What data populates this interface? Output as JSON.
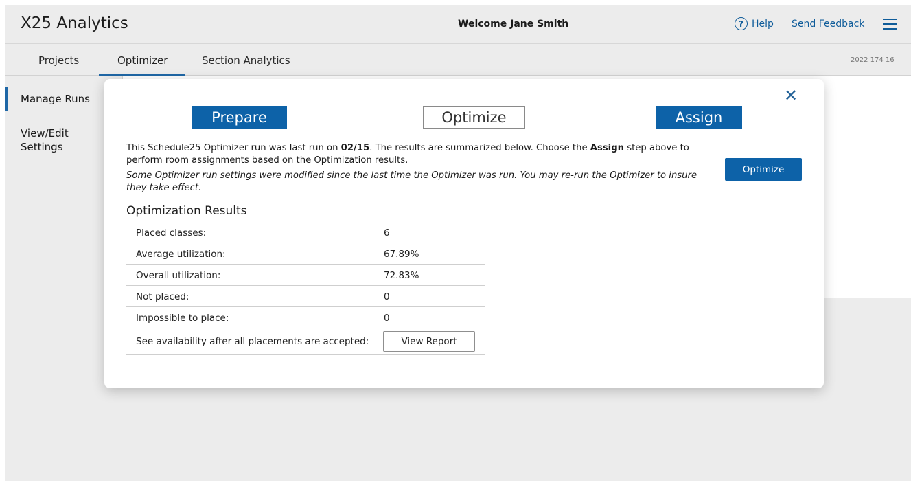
{
  "header": {
    "brand": "X25 Analytics",
    "welcome": "Welcome Jane Smith",
    "help_icon_glyph": "?",
    "help_label": "Help",
    "feedback_label": "Send Feedback"
  },
  "tabs": [
    {
      "label": "Projects"
    },
    {
      "label": "Optimizer"
    },
    {
      "label": "Section Analytics"
    }
  ],
  "version": "2022 174 16",
  "sidebar": {
    "items": [
      {
        "label": "Manage Runs"
      },
      {
        "label": "View/Edit"
      },
      {
        "label": "Settings"
      }
    ]
  },
  "modal": {
    "close_glyph": "✕",
    "steps": [
      {
        "label": "Prepare"
      },
      {
        "label": "Optimize"
      },
      {
        "label": "Assign"
      }
    ],
    "desc": {
      "part1": "This Schedule25 Optimizer run was last run on ",
      "date": "02/15",
      "part2": ". The results are summarized below. Choose the ",
      "assign": "Assign",
      "part3": " step above to perform room assignments based on the Optimization results."
    },
    "note": "Some Optimizer run settings were modified since the last time the Optimizer was run. You may re-run the Optimizer to insure they take effect.",
    "optimize_button": "Optimize",
    "results_title": "Optimization Results",
    "results": [
      {
        "label": "Placed classes:",
        "value": "6"
      },
      {
        "label": "Average utilization:",
        "value": "67.89%"
      },
      {
        "label": "Overall utilization:",
        "value": "72.83%"
      },
      {
        "label": "Not placed:",
        "value": "0"
      },
      {
        "label": "Impossible to place:",
        "value": "0"
      }
    ],
    "availability_label": "See availability after all placements are accepted:",
    "view_report_button": "View Report"
  },
  "colors": {
    "accent": "#0d62a8",
    "link": "#0f5c9a",
    "background": "#ececec"
  }
}
